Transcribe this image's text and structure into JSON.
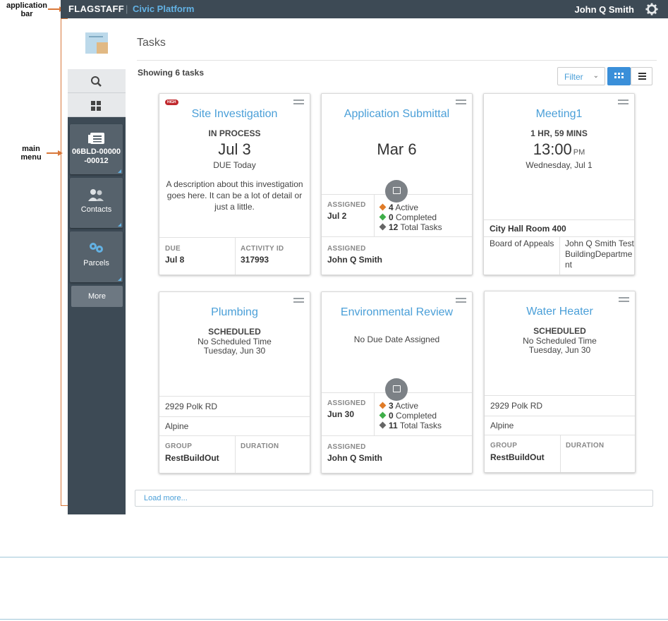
{
  "annotations": {
    "app_bar": "application\nbar",
    "main_menu": "main\nmenu"
  },
  "app": {
    "brand": "FLAGSTAFF",
    "separator": "|",
    "platform": "Civic Platform",
    "user": "John Q Smith"
  },
  "sidebar": {
    "tiles": [
      {
        "id": "06BLD-00000\n-00012",
        "icon": "record-icon"
      },
      {
        "label": "Contacts",
        "icon": "contacts-icon"
      },
      {
        "label": "Parcels",
        "icon": "parcels-icon"
      }
    ],
    "more": "More"
  },
  "main": {
    "title": "Tasks",
    "showing": "Showing 6 tasks",
    "filter": "Filter",
    "load_more": "Load more..."
  },
  "cards": {
    "c1": {
      "badge": "HIGH",
      "title": "Site Investigation",
      "status": "IN PROCESS",
      "date": "Jul 3",
      "due": "DUE Today",
      "desc": "A description about this investigation goes here. It can be a lot of detail or just a little.",
      "due_label": "DUE",
      "due_value": "Jul 8",
      "act_label": "ACTIVITY ID",
      "act_value": "317993"
    },
    "c2": {
      "title": "Application Submittal",
      "date": "Mar 6",
      "assigned_label": "ASSIGNED",
      "assigned_date": "Jul 2",
      "active": "4",
      "active_label": "Active",
      "completed": "0",
      "completed_label": "Completed",
      "total": "12",
      "total_label": "Total Tasks",
      "assignee_label": "ASSIGNED",
      "assignee": "John Q Smith"
    },
    "c3": {
      "title": "Meeting1",
      "duration": "1 HR, 59 MINS",
      "time": "13:00",
      "ampm": "PM",
      "day": "Wednesday, Jul 1",
      "location": "City Hall Room 400",
      "group": "Board of Appeals",
      "person": "John Q Smith TestBuildingDepartment"
    },
    "c4": {
      "title": "Plumbing",
      "status": "SCHEDULED",
      "line1": "No Scheduled Time",
      "line2": "Tuesday, Jun 30",
      "address": "2929 Polk RD",
      "city": "Alpine",
      "group_label": "GROUP",
      "group": "RestBuildOut",
      "dur_label": "DURATION"
    },
    "c5": {
      "title": "Environmental Review",
      "line1": "No Due Date Assigned",
      "assigned_label": "ASSIGNED",
      "assigned_date": "Jun 30",
      "active": "3",
      "active_label": "Active",
      "completed": "0",
      "completed_label": "Completed",
      "total": "11",
      "total_label": "Total Tasks",
      "assignee_label": "ASSIGNED",
      "assignee": "John Q Smith"
    },
    "c6": {
      "title": "Water Heater",
      "status": "SCHEDULED",
      "line1": "No Scheduled Time",
      "line2": "Tuesday, Jun 30",
      "address": "2929 Polk RD",
      "city": "Alpine",
      "group_label": "GROUP",
      "group": "RestBuildOut",
      "dur_label": "DURATION"
    }
  },
  "colors": {
    "accent": "#4a9fd8",
    "appbar": "#3d4a55",
    "active": "#e07b27",
    "completed": "#3fae49",
    "total": "#666666",
    "high": "#c0282d"
  }
}
